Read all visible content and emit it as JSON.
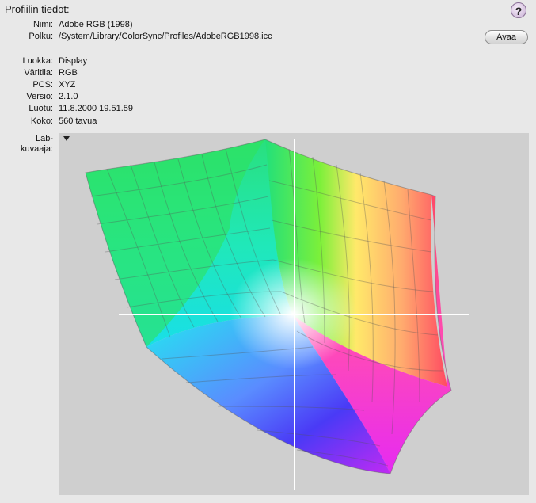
{
  "header": {
    "title": "Profiilin tiedot:",
    "help_symbol": "?"
  },
  "info": [
    {
      "label": "Nimi:",
      "value": "Adobe RGB (1998)"
    },
    {
      "label": "Polku:",
      "value": "/System/Library/ColorSync/Profiles/AdobeRGB1998.icc"
    },
    {
      "label": "Luokka:",
      "value": "Display"
    },
    {
      "label": "Väritila:",
      "value": "RGB"
    },
    {
      "label": "PCS:",
      "value": "XYZ"
    },
    {
      "label": "Versio:",
      "value": "2.1.0"
    },
    {
      "label": "Luotu:",
      "value": "11.8.2000 19.51.59"
    },
    {
      "label": "Koko:",
      "value": "560 tavua"
    }
  ],
  "buttons": {
    "open_label": "Avaa"
  },
  "plot": {
    "label_line1": "Lab-",
    "label_line2": "kuvaaja:",
    "background": "#cfcfcf"
  }
}
